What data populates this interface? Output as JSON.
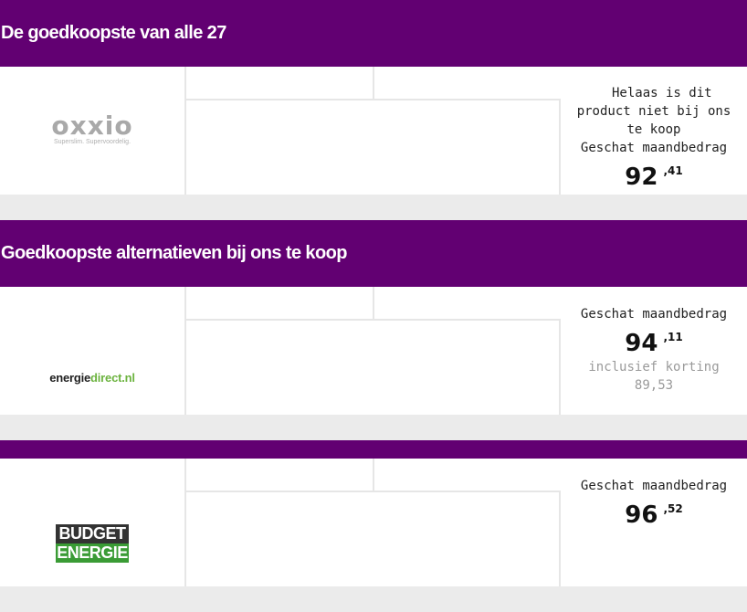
{
  "section1": {
    "title": "De goedkoopste van alle 27",
    "offer": {
      "logo_text": "oxxio",
      "logo_tagline": "Superslim. Supervoordelig.",
      "unavailable_line1": "Helaas is dit",
      "unavailable_line2": "product niet bij ons",
      "unavailable_line3": "te koop",
      "price_label": "Geschat maandbedrag",
      "price_euros": "92",
      "price_cents": ",41"
    }
  },
  "section2": {
    "title": "Goedkoopste alternatieven bij ons te koop",
    "offers": [
      {
        "logo_black": "energie",
        "logo_green": "direct",
        "logo_suffix": ".nl",
        "price_label": "Geschat maandbedrag",
        "price_euros": "94",
        "price_cents": ",11",
        "discount_label": "inclusief korting",
        "discount_price": "89,53"
      },
      {
        "logo_line1": "BUDGET",
        "logo_line2": "ENERGIE",
        "price_label": "Geschat maandbedrag",
        "price_euros": "96",
        "price_cents": ",52"
      }
    ]
  },
  "colors": {
    "header_bg": "#620072",
    "page_bg": "#ebebeb",
    "card_bg": "#ffffff"
  }
}
